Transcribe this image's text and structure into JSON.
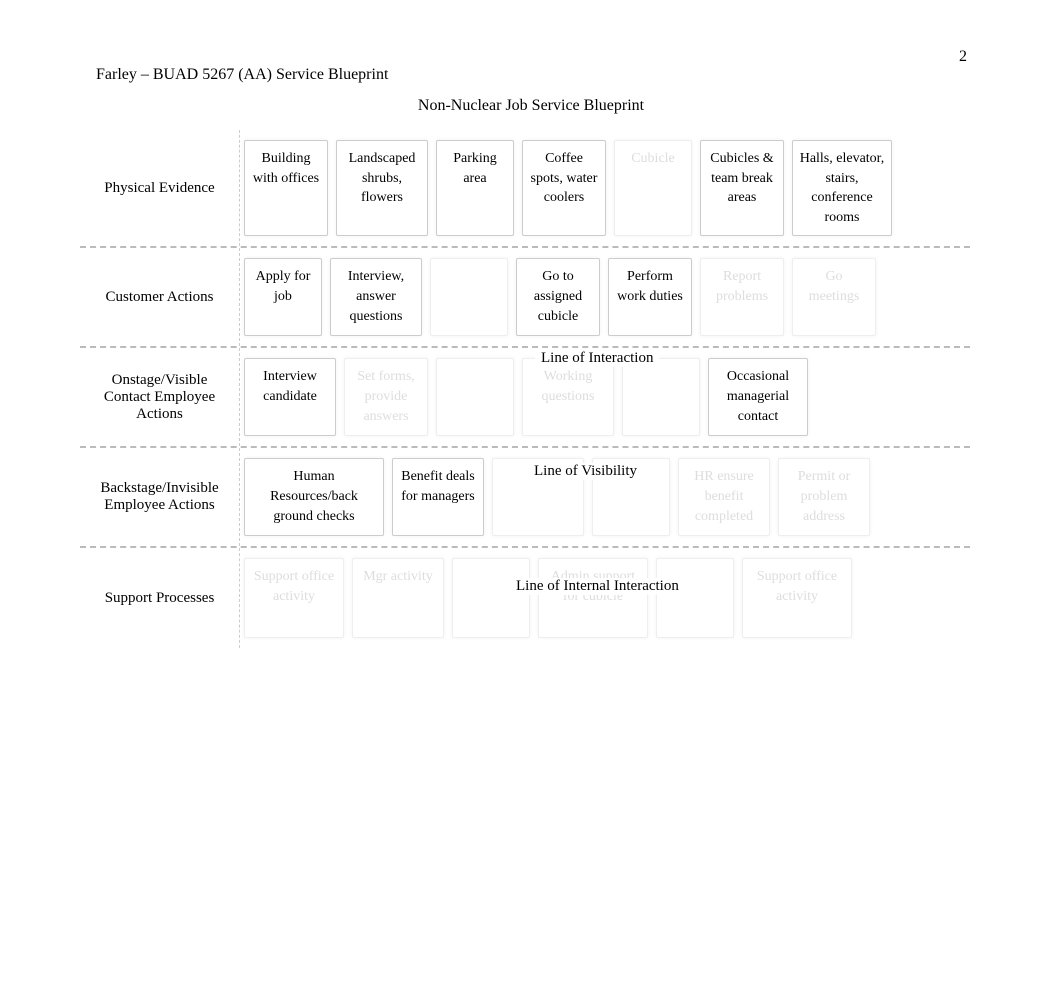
{
  "page_number": "2",
  "header": "Farley – BUAD 5267 (AA) Service Blueprint",
  "title": "Non-Nuclear Job Service Blueprint",
  "lines": {
    "interaction": "Line of Interaction",
    "visibility": "Line of Visibility",
    "internal": "Line of Internal Interaction"
  },
  "rows": [
    {
      "label": "Physical Evidence",
      "cells": [
        {
          "text": "Building with offices",
          "faded": false,
          "w": "w80"
        },
        {
          "text": "Landscaped shrubs, flowers",
          "faded": false,
          "w": "w90"
        },
        {
          "text": "Parking area",
          "faded": false,
          "w": "w70"
        },
        {
          "text": "Coffee spots, water coolers",
          "faded": false,
          "w": "w80"
        },
        {
          "text": "Cubicle",
          "faded": true,
          "w": "w70"
        },
        {
          "text": "Cubicles & team break areas",
          "faded": false,
          "w": "w80"
        },
        {
          "text": "Halls, elevator, stairs, conference rooms",
          "faded": false,
          "w": "w100"
        }
      ]
    },
    {
      "label": "Customer Actions",
      "cells": [
        {
          "text": "Apply for job",
          "faded": false,
          "w": "w70"
        },
        {
          "text": "Interview, answer questions",
          "faded": false,
          "w": "w90"
        },
        {
          "text": "",
          "faded": true,
          "w": "w70"
        },
        {
          "text": "Go to assigned cubicle",
          "faded": false,
          "w": "w80"
        },
        {
          "text": "Perform work duties",
          "faded": false,
          "w": "w80"
        },
        {
          "text": "Report problems",
          "faded": true,
          "w": "w80"
        },
        {
          "text": "Go meetings",
          "faded": true,
          "w": "w80"
        }
      ]
    },
    {
      "label": "Onstage/Visible Contact Employee Actions",
      "cells": [
        {
          "text": "Interview candidate",
          "faded": false,
          "w": "w90"
        },
        {
          "text": "Set forms, provide answers",
          "faded": true,
          "w": "w80"
        },
        {
          "text": "",
          "faded": true,
          "w": "w70"
        },
        {
          "text": "Working questions",
          "faded": true,
          "w": "w90"
        },
        {
          "text": "",
          "faded": true,
          "w": "w70"
        },
        {
          "text": "Occasional managerial contact",
          "faded": false,
          "w": "w100"
        }
      ]
    },
    {
      "label": "Backstage/Invisible Employee Actions",
      "cells": [
        {
          "text": "Human Resources/back ground checks",
          "faded": false,
          "w": "w140"
        },
        {
          "text": "Benefit deals for managers",
          "faded": false,
          "w": "w90"
        },
        {
          "text": "",
          "faded": true,
          "w": "w90"
        },
        {
          "text": "",
          "faded": true,
          "w": "w70"
        },
        {
          "text": "HR ensure benefit completed",
          "faded": true,
          "w": "w90"
        },
        {
          "text": "Permit or problem address",
          "faded": true,
          "w": "w90"
        }
      ]
    },
    {
      "label": "Support Processes",
      "cells": [
        {
          "text": "Support office activity",
          "faded": true,
          "w": "w100"
        },
        {
          "text": "Mgr activity",
          "faded": true,
          "w": "w90"
        },
        {
          "text": "",
          "faded": true,
          "w": "w70"
        },
        {
          "text": "Admin support for cubicle",
          "faded": true,
          "w": "w110"
        },
        {
          "text": "",
          "faded": true,
          "w": "w70"
        },
        {
          "text": "Support office activity",
          "faded": true,
          "w": "w110"
        }
      ]
    }
  ]
}
